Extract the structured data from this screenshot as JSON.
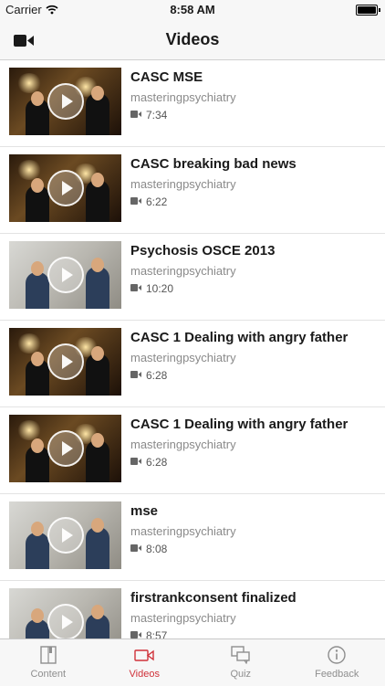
{
  "status_bar": {
    "carrier": "Carrier",
    "time": "8:58 AM"
  },
  "nav": {
    "title": "Videos"
  },
  "colors": {
    "accent": "#d0323a",
    "inactive": "#8e8e8e"
  },
  "videos": [
    {
      "title": "CASC MSE",
      "channel": "masteringpsychiatry",
      "duration": "7:34"
    },
    {
      "title": "CASC breaking bad news",
      "channel": "masteringpsychiatry",
      "duration": "6:22"
    },
    {
      "title": "Psychosis OSCE 2013",
      "channel": "masteringpsychiatry",
      "duration": "10:20"
    },
    {
      "title": "CASC 1 Dealing with angry father",
      "channel": "masteringpsychiatry",
      "duration": "6:28"
    },
    {
      "title": "CASC 1 Dealing with angry father",
      "channel": "masteringpsychiatry",
      "duration": "6:28"
    },
    {
      "title": "mse",
      "channel": "masteringpsychiatry",
      "duration": "8:08"
    },
    {
      "title": "firstrankconsent finalized",
      "channel": "masteringpsychiatry",
      "duration": "8:57"
    }
  ],
  "tabs": [
    {
      "label": "Content",
      "icon": "book-icon"
    },
    {
      "label": "Videos",
      "icon": "video-camera-icon",
      "active": true
    },
    {
      "label": "Quiz",
      "icon": "chat-bubbles-icon"
    },
    {
      "label": "Feedback",
      "icon": "info-icon"
    }
  ]
}
